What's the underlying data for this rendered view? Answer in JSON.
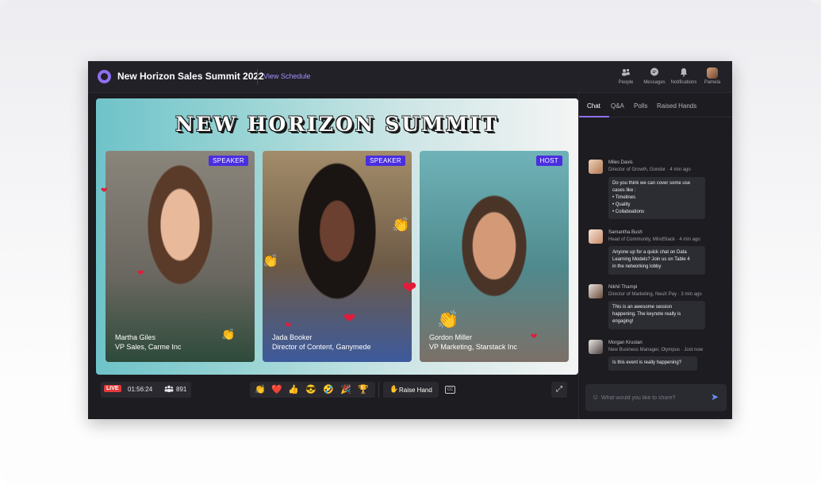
{
  "header": {
    "title": "New Horizon Sales Summit 2022",
    "view_schedule": "View Schedule",
    "nav": [
      {
        "label": "People",
        "icon": "people-icon"
      },
      {
        "label": "Messages",
        "icon": "message-icon"
      },
      {
        "label": "Notifications",
        "icon": "bell-icon"
      },
      {
        "label": "Pamela",
        "icon": "avatar"
      }
    ]
  },
  "stage": {
    "banner": "NEW HORIZON SUMMIT",
    "tiles": [
      {
        "badge": "SPEAKER",
        "name": "Martha Giles",
        "role": "VP Sales, Carme Inc"
      },
      {
        "badge": "SPEAKER",
        "name": "Jada Booker",
        "role": "Director of Content, Ganymede"
      },
      {
        "badge": "HOST",
        "name": "Gordon Miller",
        "role": "VP Marketing, Starstack Inc"
      }
    ]
  },
  "controls": {
    "live_label": "LIVE",
    "timer": "01:56:24",
    "viewers": "891",
    "reactions": [
      "👏",
      "❤️",
      "👍",
      "😎",
      "🤣",
      "🎉",
      "🏆"
    ],
    "raise_hand": "Raise Hand",
    "cc": "CC"
  },
  "chat": {
    "tabs": [
      "Chat",
      "Q&A",
      "Polls",
      "Raised Hands"
    ],
    "messages": [
      {
        "name": "Miles Davis",
        "meta": "Director of Growth, Gondor · 4 min ago",
        "lines": [
          "Do you think we can cover some use",
          "cases like :",
          "• Timelines",
          "• Quality",
          "• Collaboations"
        ]
      },
      {
        "name": "Samantha Bush",
        "meta": "Head of Community, MindStack · 4 min ago",
        "lines": [
          "Anyone up for a quick chat on Data",
          "Learning Models? Join us on Table 4",
          "in the networking lobby"
        ]
      },
      {
        "name": "Nikhil Thampi",
        "meta": "Director of Marketing, NeuX Pay · 3 min ago",
        "lines": [
          "This is an awesome session",
          "happening. The keynote really is",
          "engaging!"
        ]
      },
      {
        "name": "Morgan Krustan",
        "meta": "New Business Manager, Olympus · Just now",
        "lines": [
          "Is this event is really happening?"
        ]
      }
    ],
    "input_placeholder": "What would you like to share?"
  },
  "colors": {
    "accent": "#8f6ff0",
    "badge": "#4a2ee0",
    "live": "#e23a3a",
    "panel": "#1c1c21"
  }
}
